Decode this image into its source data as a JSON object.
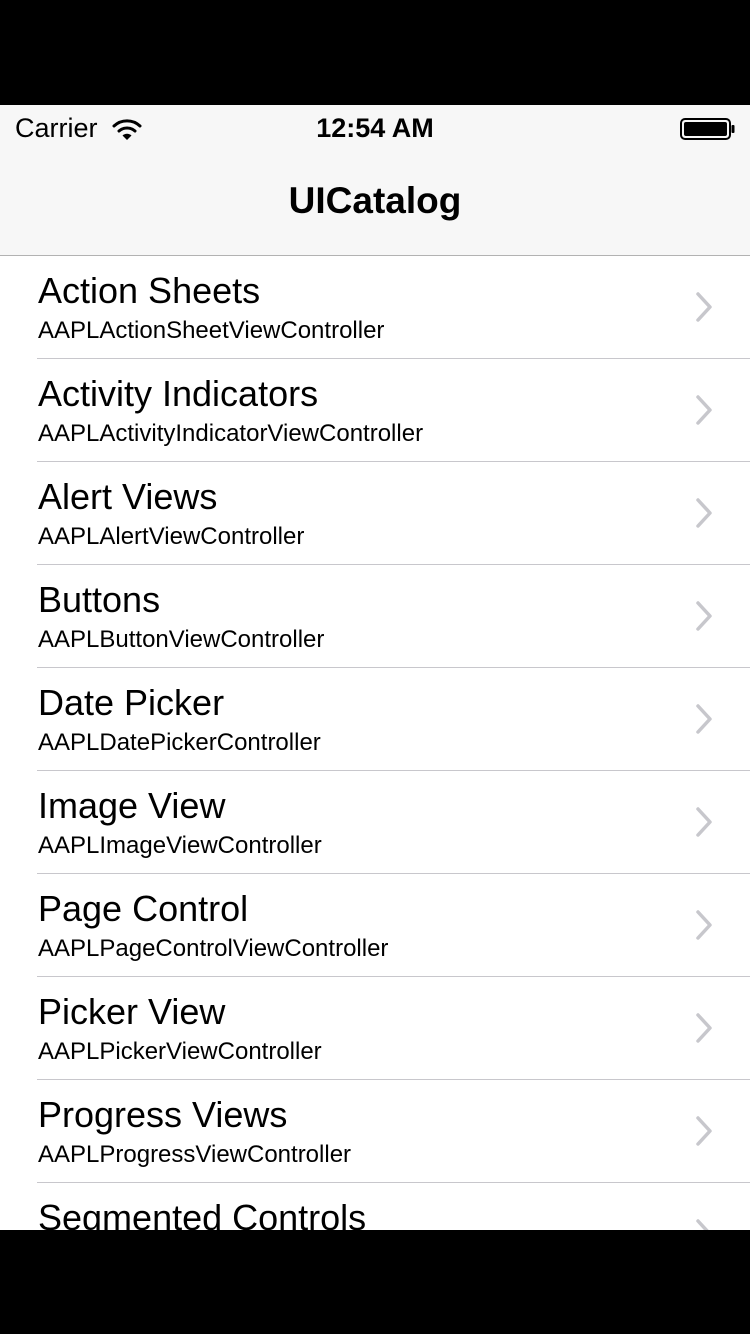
{
  "status_bar": {
    "carrier": "Carrier",
    "time": "12:54 AM",
    "wifi_icon": "wifi-icon",
    "battery_icon": "battery-icon"
  },
  "nav": {
    "title": "UICatalog"
  },
  "colors": {
    "nav_background": "#f7f7f7",
    "separator": "#c8c7cc",
    "chevron": "#c7c7cc",
    "text": "#000000"
  },
  "items": [
    {
      "title": "Action Sheets",
      "subtitle": "AAPLActionSheetViewController",
      "icon": "chevron-right-icon"
    },
    {
      "title": "Activity Indicators",
      "subtitle": "AAPLActivityIndicatorViewController",
      "icon": "chevron-right-icon"
    },
    {
      "title": "Alert Views",
      "subtitle": "AAPLAlertViewController",
      "icon": "chevron-right-icon"
    },
    {
      "title": "Buttons",
      "subtitle": "AAPLButtonViewController",
      "icon": "chevron-right-icon"
    },
    {
      "title": "Date Picker",
      "subtitle": "AAPLDatePickerController",
      "icon": "chevron-right-icon"
    },
    {
      "title": "Image View",
      "subtitle": "AAPLImageViewController",
      "icon": "chevron-right-icon"
    },
    {
      "title": "Page Control",
      "subtitle": "AAPLPageControlViewController",
      "icon": "chevron-right-icon"
    },
    {
      "title": "Picker View",
      "subtitle": "AAPLPickerViewController",
      "icon": "chevron-right-icon"
    },
    {
      "title": "Progress Views",
      "subtitle": "AAPLProgressViewController",
      "icon": "chevron-right-icon"
    },
    {
      "title": "Segmented Controls",
      "subtitle": "",
      "icon": "chevron-right-icon"
    }
  ]
}
